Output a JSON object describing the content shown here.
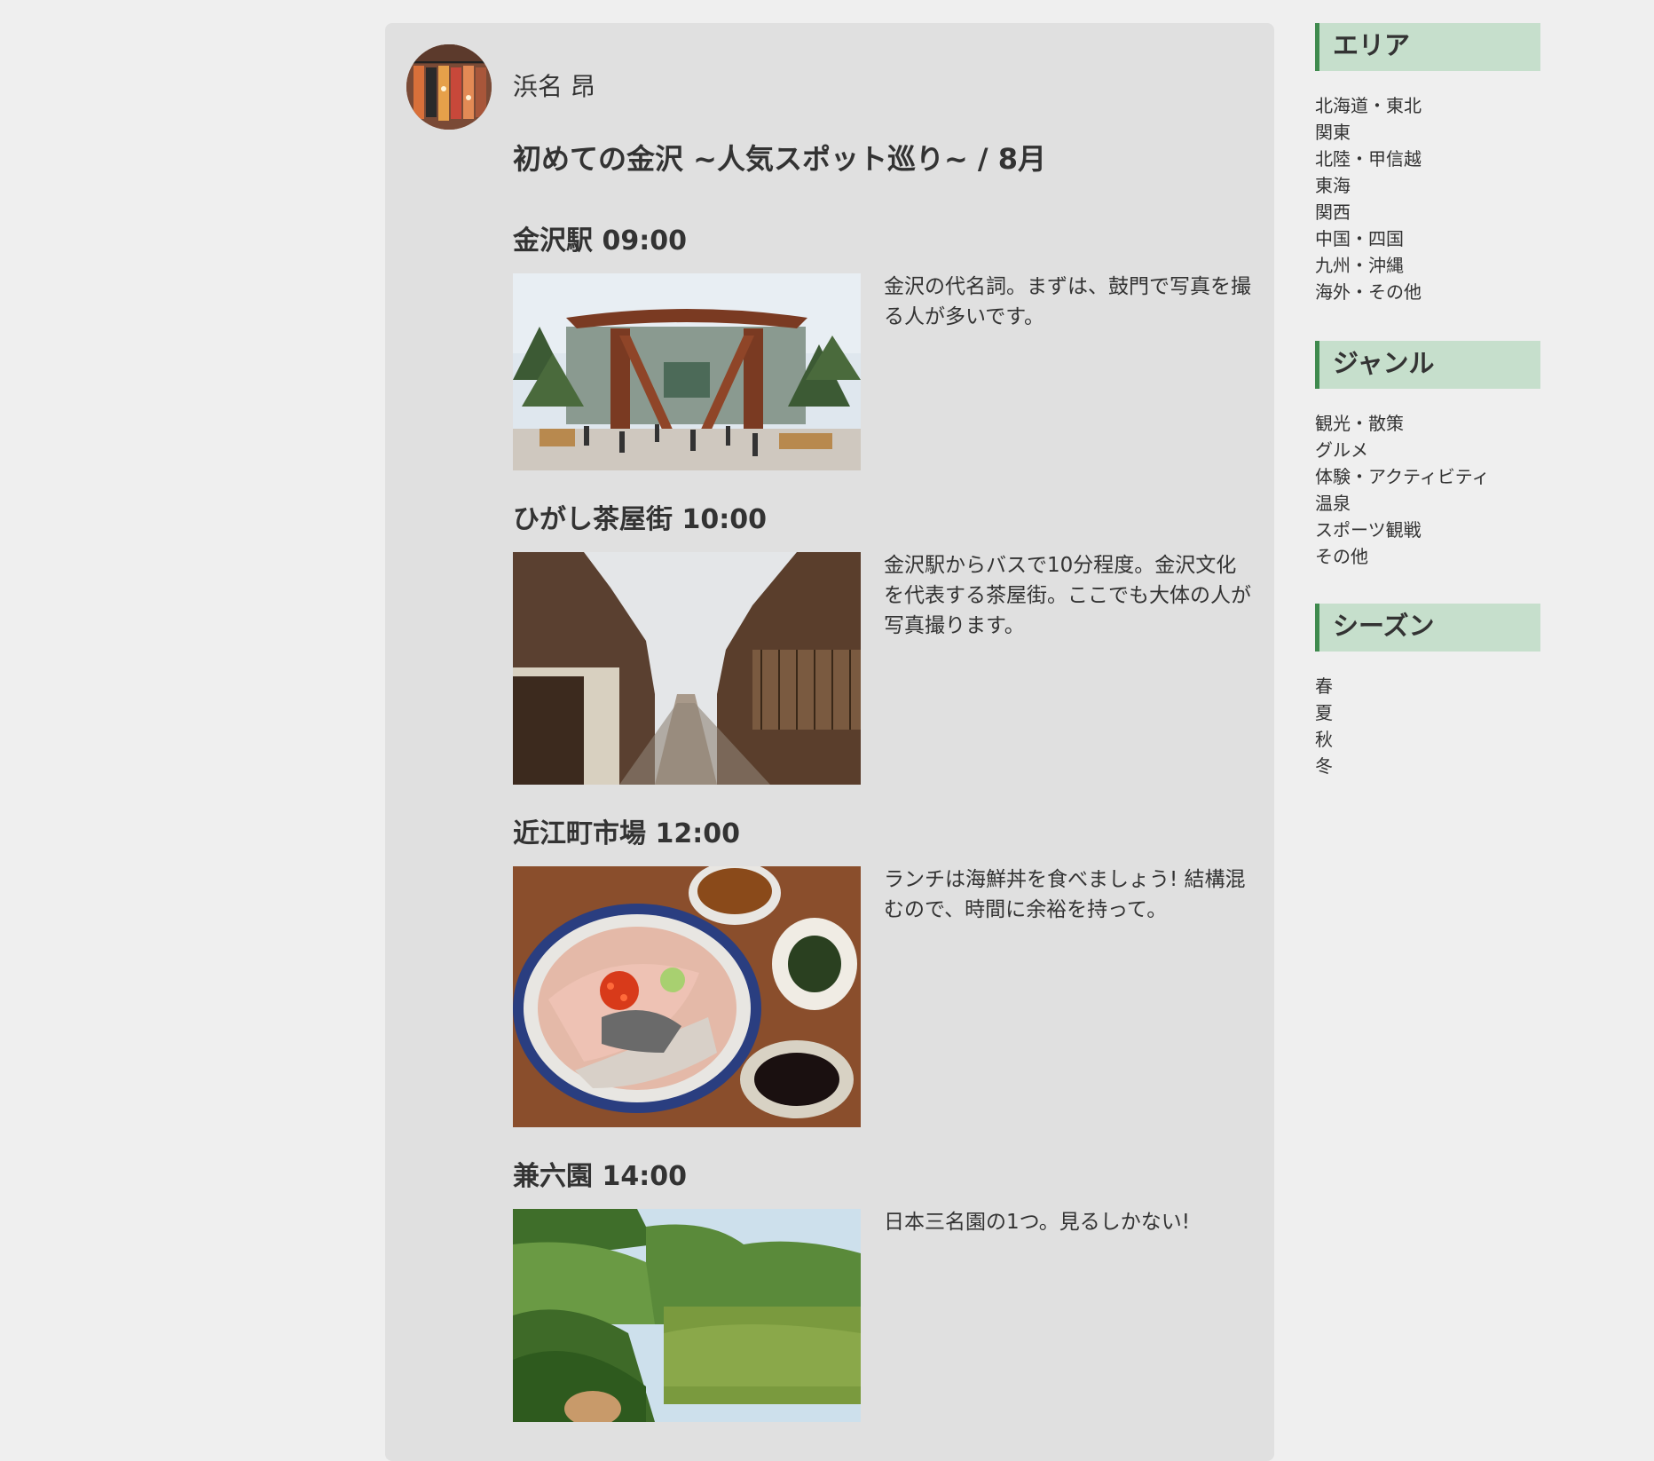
{
  "author": {
    "name": "浜名 昂"
  },
  "trip": {
    "title": "初めての金沢 ~人気スポット巡り~ / 8月",
    "stops": [
      {
        "heading": "金沢駅 09:00",
        "description": "金沢の代名詞。まずは、鼓門で写真を撮る人が多いです。"
      },
      {
        "heading": "ひがし茶屋街 10:00",
        "description": "金沢駅からバスで10分程度。金沢文化を代表する茶屋街。ここでも大体の人が写真撮ります。"
      },
      {
        "heading": "近江町市場 12:00",
        "description": "ランチは海鮮丼を食べましょう! 結構混むので、時間に余裕を持って。"
      },
      {
        "heading": "兼六園 14:00",
        "description": "日本三名園の1つ。見るしかない!"
      }
    ]
  },
  "sidebar": {
    "area": {
      "title": "エリア",
      "items": [
        "北海道・東北",
        "関東",
        "北陸・甲信越",
        "東海",
        "関西",
        "中国・四国",
        "九州・沖縄",
        "海外・その他"
      ]
    },
    "genre": {
      "title": "ジャンル",
      "items": [
        "観光・散策",
        "グルメ",
        "体験・アクティビティ",
        "温泉",
        "スポーツ観戦",
        "その他"
      ]
    },
    "season": {
      "title": "シーズン",
      "items": [
        "春",
        "夏",
        "秋",
        "冬"
      ]
    }
  },
  "colors": {
    "page_background": "#efefef",
    "card_background": "#e0e0e0",
    "sidebar_header_background": "#c6dfcc",
    "sidebar_header_accent": "#3f8a4e",
    "text": "#333333"
  }
}
